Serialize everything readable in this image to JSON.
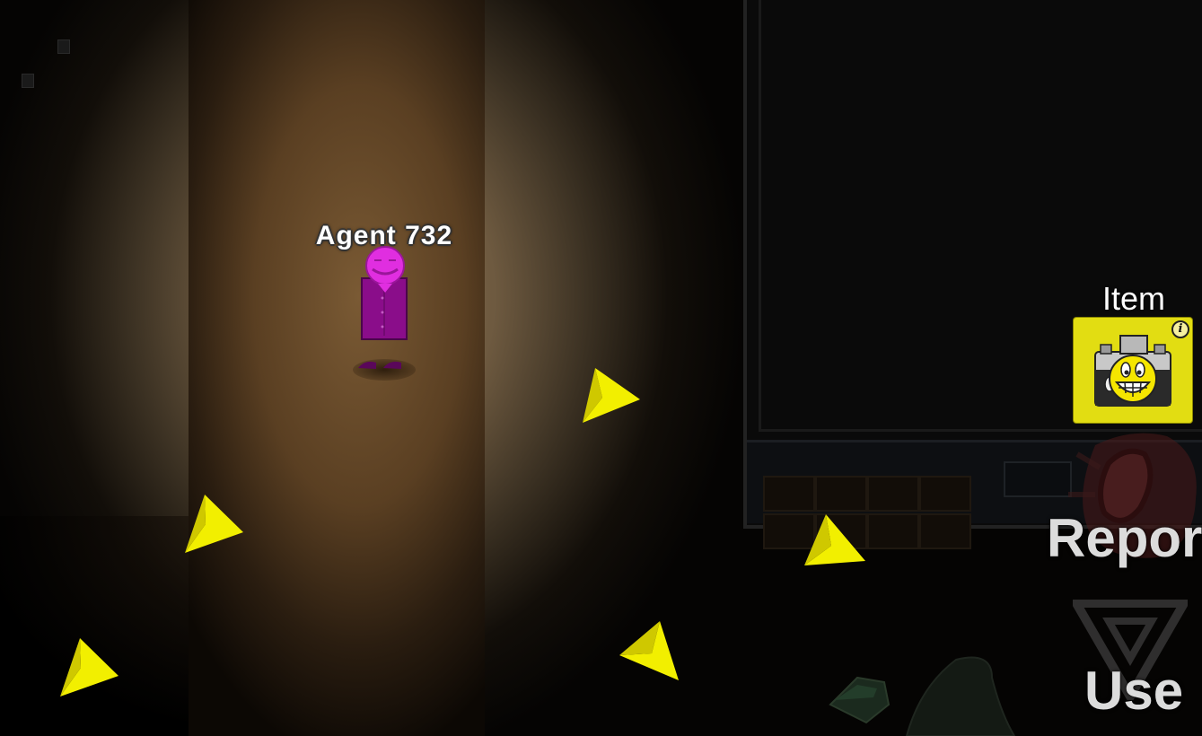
{
  "player": {
    "name": "Agent 732",
    "color": "#e02ee0",
    "body_color": "#8a0d8a"
  },
  "hud": {
    "item_label": "Item",
    "item_icon": "camera-smiley-icon",
    "info_icon": "info-icon",
    "info_glyph": "i",
    "report_label": "Report",
    "use_label": "Use"
  },
  "colors": {
    "item_slot": "#e2dd12",
    "arrow": "#f2ef00",
    "hud_text": "#dcdcdc"
  },
  "arrows": [
    {
      "name": "direction-arrow-1"
    },
    {
      "name": "direction-arrow-2"
    },
    {
      "name": "direction-arrow-3"
    },
    {
      "name": "direction-arrow-4"
    },
    {
      "name": "direction-arrow-5"
    }
  ]
}
